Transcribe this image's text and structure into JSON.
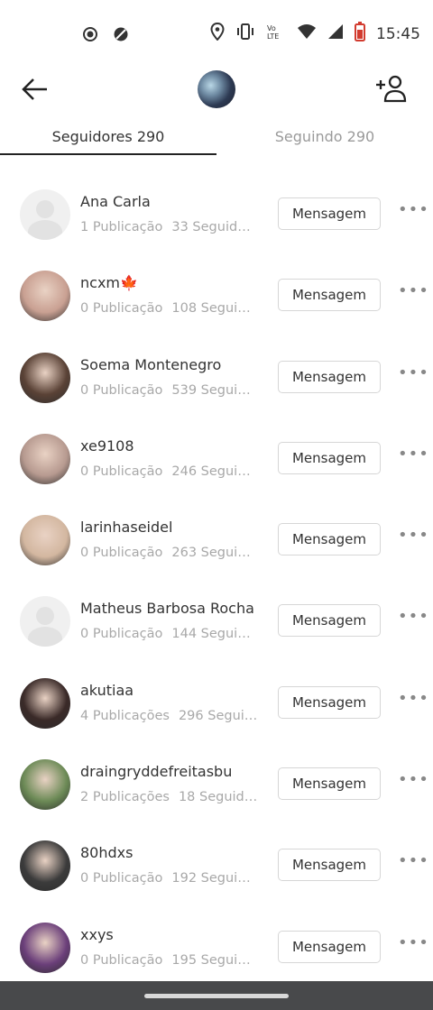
{
  "status_bar": {
    "time": "15:45",
    "icons_left": [
      "record-icon",
      "blocked-icon"
    ],
    "icons_right": [
      "location-icon",
      "vibrate-icon",
      "volte-icon",
      "wifi-icon",
      "signal-icon",
      "battery-icon"
    ]
  },
  "header": {
    "back_icon": "arrow-left-icon",
    "profile_avatar": "profile-avatar",
    "add_icon": "add-user-icon"
  },
  "tabs": [
    {
      "label": "Seguidores 290",
      "active": true
    },
    {
      "label": "Seguindo 290",
      "active": false
    }
  ],
  "followers": [
    {
      "name": "Ana Carla",
      "pubs": "1 Publicação",
      "followers": "33 Seguidores",
      "avatar": "placeholder",
      "button": "Mensagem"
    },
    {
      "name": "ncxm🍁",
      "pubs": "0 Publicação",
      "followers": "108 Seguidores",
      "avatar": "photo",
      "avatar_color": "#c9a092",
      "button": "Mensagem"
    },
    {
      "name": "Soema Montenegro",
      "pubs": "0 Publicação",
      "followers": "539 Seguidores",
      "avatar": "photo",
      "avatar_color": "#5a4236",
      "button": "Mensagem"
    },
    {
      "name": "xe9108",
      "pubs": "0 Publicação",
      "followers": "246 Seguidores",
      "avatar": "photo",
      "avatar_color": "#b79a90",
      "button": "Mensagem"
    },
    {
      "name": "larinhaseidel",
      "pubs": "0 Publicação",
      "followers": "263 Seguidores",
      "avatar": "photo",
      "avatar_color": "#d3b7a0",
      "button": "Mensagem"
    },
    {
      "name": "Matheus Barbosa Rocha",
      "pubs": "0 Publicação",
      "followers": "144 Seguidores",
      "avatar": "placeholder",
      "button": "Mensagem"
    },
    {
      "name": "akutiaa",
      "pubs": "4 Publicações",
      "followers": "296 Seguidores",
      "avatar": "photo",
      "avatar_color": "#3a2a28",
      "button": "Mensagem"
    },
    {
      "name": "draingryddefreitasbu",
      "pubs": "2 Publicações",
      "followers": "18 Seguidores",
      "avatar": "photo",
      "avatar_color": "#6c8a56",
      "button": "Mensagem"
    },
    {
      "name": "80hdxs",
      "pubs": "0 Publicação",
      "followers": "192 Seguidores",
      "avatar": "photo",
      "avatar_color": "#3b3b3b",
      "button": "Mensagem"
    },
    {
      "name": "xxys",
      "pubs": "0 Publicação",
      "followers": "195 Seguidores",
      "avatar": "photo",
      "avatar_color": "#6b3f7a",
      "button": "Mensagem"
    }
  ]
}
